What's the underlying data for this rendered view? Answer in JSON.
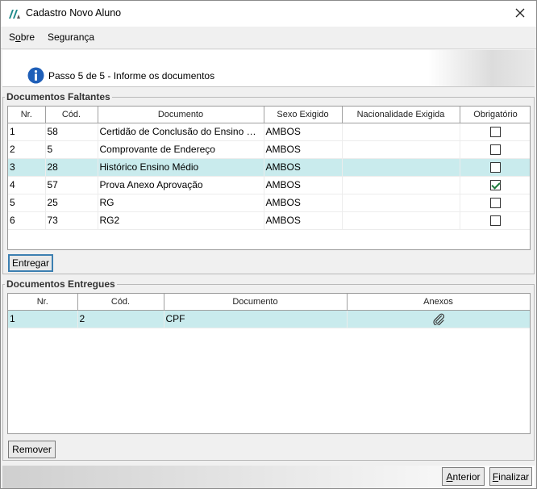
{
  "window": {
    "title": "Cadastro Novo Aluno"
  },
  "menu": [
    {
      "label_pre": "S",
      "label_ul": "o",
      "label_post": "bre"
    },
    {
      "label_pre": "",
      "label_ul": "",
      "label_post": "Segurança"
    }
  ],
  "step": {
    "text": "Passo 5 de 5 - Informe os documentos"
  },
  "missing": {
    "legend": "Documentos Faltantes",
    "columns": [
      "Nr.",
      "Cód.",
      "Documento",
      "Sexo Exigido",
      "Nacionalidade Exigida",
      "Obrigatório"
    ],
    "rows": [
      {
        "nr": "1",
        "cod": "58",
        "doc": "Certidão de Conclusão do Ensino M...",
        "sexo": "AMBOS",
        "nac": "",
        "obrig": false,
        "selected": false
      },
      {
        "nr": "2",
        "cod": "5",
        "doc": "Comprovante de Endereço",
        "sexo": "AMBOS",
        "nac": "",
        "obrig": false,
        "selected": false
      },
      {
        "nr": "3",
        "cod": "28",
        "doc": "Histórico Ensino Médio",
        "sexo": "AMBOS",
        "nac": "",
        "obrig": false,
        "selected": true
      },
      {
        "nr": "4",
        "cod": "57",
        "doc": "Prova Anexo Aprovação",
        "sexo": "AMBOS",
        "nac": "",
        "obrig": true,
        "selected": false
      },
      {
        "nr": "5",
        "cod": "25",
        "doc": "RG",
        "sexo": "AMBOS",
        "nac": "",
        "obrig": false,
        "selected": false
      },
      {
        "nr": "6",
        "cod": "73",
        "doc": "RG2",
        "sexo": "AMBOS",
        "nac": "",
        "obrig": false,
        "selected": false
      }
    ],
    "button": "Entregar"
  },
  "delivered": {
    "legend": "Documentos Entregues",
    "columns": [
      "Nr.",
      "Cód.",
      "Documento",
      "Anexos"
    ],
    "rows": [
      {
        "nr": "1",
        "cod": "2",
        "doc": "CPF",
        "attachment_icon": "paperclip-icon",
        "selected": true
      }
    ],
    "button": "Remover"
  },
  "footer": {
    "prev_pre": "",
    "prev_ul": "A",
    "prev_post": "nterior",
    "finish_pre": "",
    "finish_ul": "F",
    "finish_post": "inalizar"
  },
  "colors": {
    "selected_row": "#c9ebed",
    "info_icon": "#1f5fb8",
    "logo": "#1f8a8a"
  }
}
